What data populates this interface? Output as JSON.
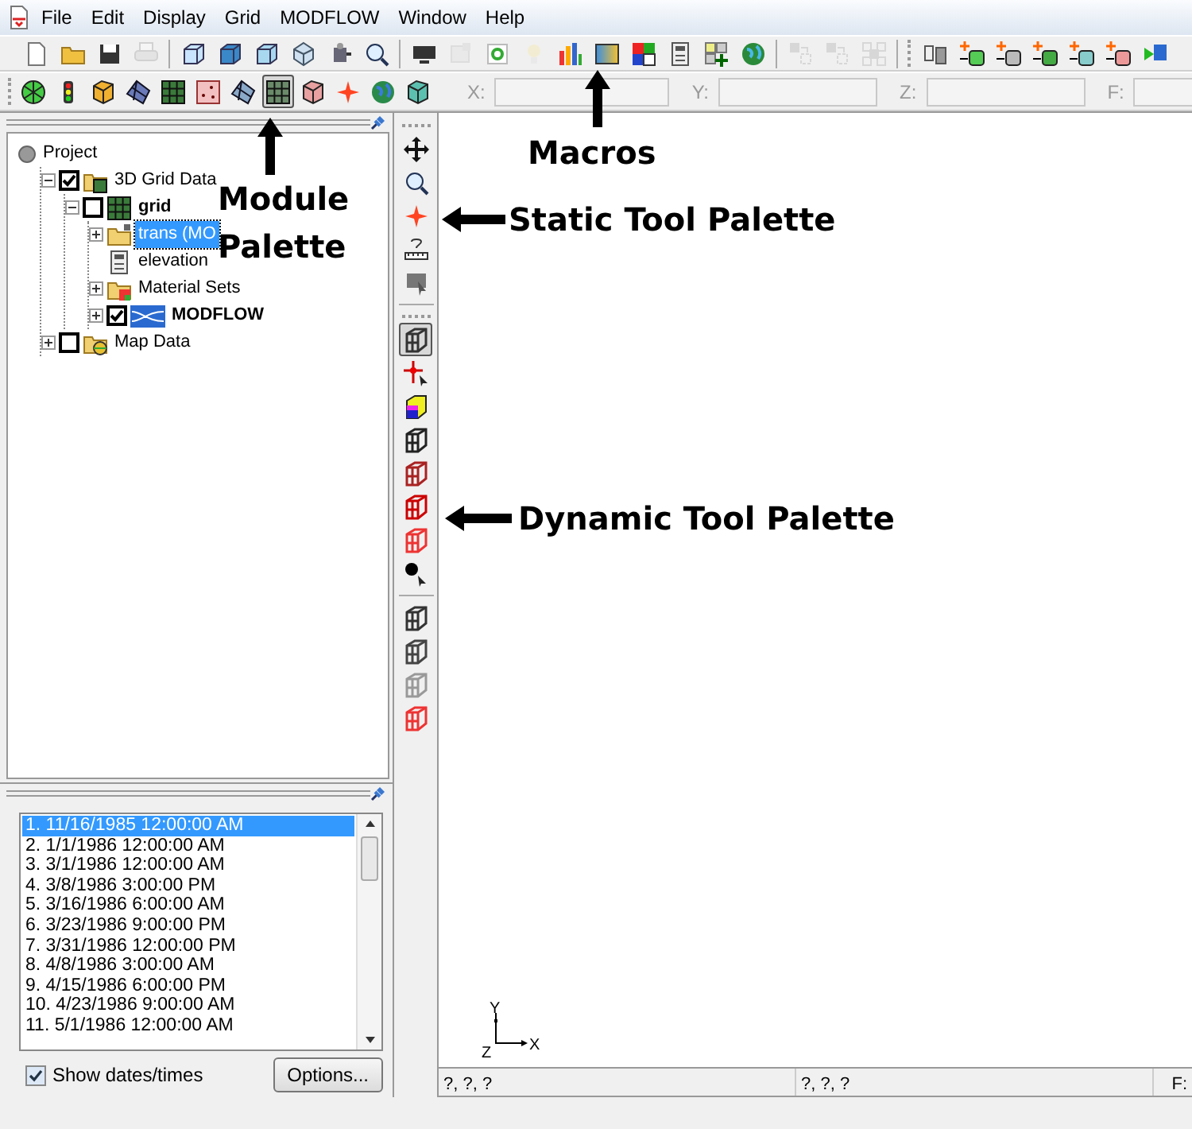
{
  "menu": [
    "File",
    "Edit",
    "Display",
    "Grid",
    "MODFLOW",
    "Window",
    "Help"
  ],
  "main_toolbar": [
    {
      "disabled": false
    },
    {
      "disabled": false
    },
    {
      "disabled": false
    },
    {
      "disabled": true
    },
    {
      "disabled": false
    },
    {
      "disabled": false
    },
    {
      "disabled": false
    },
    {
      "disabled": false
    },
    {
      "disabled": false
    },
    {
      "disabled": false
    },
    {
      "disabled": false
    },
    {
      "disabled": true
    },
    {
      "disabled": false
    },
    {
      "disabled": true
    },
    {
      "disabled": false
    },
    {
      "disabled": false
    },
    {
      "disabled": false
    },
    {
      "disabled": false
    },
    {
      "disabled": false
    },
    {
      "disabled": false
    },
    {
      "disabled": true
    },
    {
      "disabled": true
    },
    {
      "disabled": true
    },
    {
      "disabled": false
    },
    {
      "disabled": false
    },
    {
      "disabled": false
    },
    {
      "disabled": false
    },
    {
      "disabled": false
    },
    {
      "disabled": false
    },
    {
      "disabled": false
    }
  ],
  "module_palette": [
    {
      "selected": false
    },
    {
      "selected": false
    },
    {
      "selected": false
    },
    {
      "selected": false
    },
    {
      "selected": false
    },
    {
      "selected": false
    },
    {
      "selected": false
    },
    {
      "selected": true
    },
    {
      "selected": false
    },
    {
      "selected": false
    },
    {
      "selected": false
    },
    {
      "selected": false
    }
  ],
  "coordinate_fields": [
    {
      "label": "X:"
    },
    {
      "label": "Y:"
    },
    {
      "label": "Z:"
    },
    {
      "label": "F:"
    }
  ],
  "project_tree": {
    "label": "Project",
    "kind": "project",
    "selected": false,
    "bold": false,
    "children": [
      {
        "label": "3D Grid Data",
        "kind": "grid-folder",
        "selected": false,
        "bold": false,
        "checked": true,
        "expanded": true,
        "children": [
          {
            "label": "grid",
            "kind": "grid",
            "selected": false,
            "bold": true,
            "checked": false,
            "expanded": true,
            "children": [
              {
                "label": "trans (MO",
                "kind": "locked-folder",
                "selected": true,
                "bold": false,
                "expanded": false
              },
              {
                "label": "elevation",
                "kind": "dataset",
                "selected": false,
                "bold": false
              },
              {
                "label": "Material Sets",
                "kind": "material-folder",
                "selected": false,
                "bold": false,
                "expanded": false
              },
              {
                "label": "MODFLOW",
                "kind": "model",
                "selected": false,
                "bold": true,
                "checked": true,
                "expanded": false
              }
            ]
          }
        ]
      },
      {
        "label": "Map Data",
        "kind": "map-folder",
        "selected": false,
        "bold": false,
        "checked": false,
        "expanded": false
      }
    ]
  },
  "dynamic_tools": [
    {
      "selected": true
    },
    {
      "selected": false
    },
    {
      "selected": false
    },
    {
      "selected": false
    },
    {
      "selected": false
    },
    {
      "selected": false
    },
    {
      "selected": false
    },
    {
      "selected": false
    },
    {
      "selected": false
    },
    {
      "selected": false
    },
    {
      "selected": false
    },
    {
      "selected": false
    }
  ],
  "time_steps": {
    "items": [
      {
        "label": "1.  11/16/1985 12:00:00 AM",
        "selected": true
      },
      {
        "label": "2.  1/1/1986 12:00:00 AM",
        "selected": false
      },
      {
        "label": "3.  3/1/1986 12:00:00 AM",
        "selected": false
      },
      {
        "label": "4.  3/8/1986 3:00:00 PM",
        "selected": false
      },
      {
        "label": "5.  3/16/1986 6:00:00 AM",
        "selected": false
      },
      {
        "label": "6.  3/23/1986 9:00:00 PM",
        "selected": false
      },
      {
        "label": "7.  3/31/1986 12:00:00 PM",
        "selected": false
      },
      {
        "label": "8.  4/8/1986 3:00:00 AM",
        "selected": false
      },
      {
        "label": "9.  4/15/1986 6:00:00 PM",
        "selected": false
      },
      {
        "label": "10.  4/23/1986 9:00:00 AM",
        "selected": false
      },
      {
        "label": "11.  5/1/1986 12:00:00 AM",
        "selected": false
      }
    ],
    "show_dates_times": {
      "label": "Show dates/times",
      "checked": true
    },
    "options_button": "Options..."
  },
  "axis_labels": {
    "y": "Y",
    "z": "Z",
    "x": "X"
  },
  "status_bar": [
    "?, ?, ?",
    "?, ?, ?",
    "F:"
  ],
  "annotations": [
    {
      "text": "Macros",
      "kind": "macros"
    },
    {
      "text": "Module Palette",
      "kind": "module"
    },
    {
      "text": "Static Tool Palette",
      "kind": "static"
    },
    {
      "text": "Dynamic Tool Palette",
      "kind": "dynamic"
    }
  ]
}
